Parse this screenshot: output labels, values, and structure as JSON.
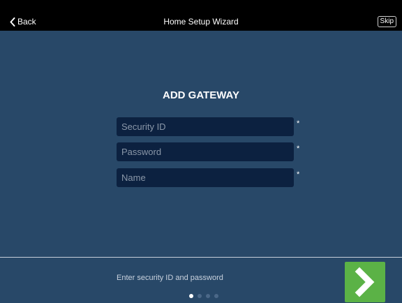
{
  "nav": {
    "back_label": "Back",
    "title": "Home Setup Wizard",
    "skip_label": "Skip"
  },
  "main": {
    "heading": "ADD GATEWAY",
    "fields": [
      {
        "placeholder": "Security ID",
        "value": "",
        "required_mark": "*"
      },
      {
        "placeholder": "Password",
        "value": "",
        "required_mark": "*"
      },
      {
        "placeholder": "Name",
        "value": "",
        "required_mark": "*"
      }
    ]
  },
  "footer": {
    "hint": "Enter security ID and password",
    "pager": {
      "total": 4,
      "active": 1
    },
    "next_color": "#5bb246"
  },
  "colors": {
    "background": "#284868",
    "field": "#0c2140",
    "topbar": "#000000"
  }
}
